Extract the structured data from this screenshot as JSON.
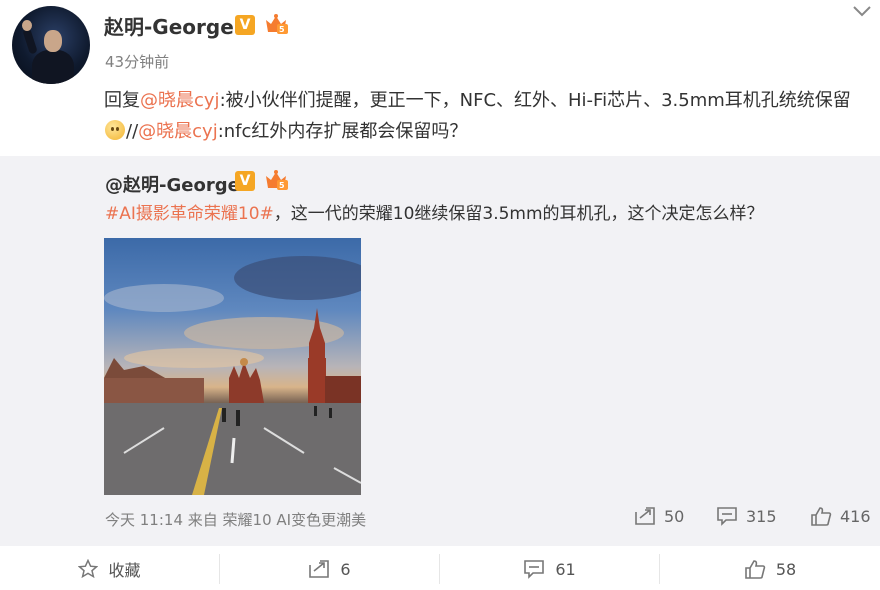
{
  "header": {
    "user_name": "赵明-George",
    "verified_badge": "V",
    "post_time": "43分钟前"
  },
  "post": {
    "prefix": "回复",
    "mention1": "@晓晨cyj",
    "text1": ":被小伙伴们提醒，更正一下，NFC、红外、Hi-Fi芯片、3.5mm耳机孔统统保留",
    "emoji": "smile-emoji",
    "slashes": "//",
    "mention2": "@晓晨cyj",
    "text2": ":nfc红外内存扩展都会保留吗？"
  },
  "retweet": {
    "user_name": "@赵明-George",
    "verified_badge": "V",
    "hashtag": "#AI摄影革命荣耀10#",
    "text": "，这一代的荣耀10继续保留3.5mm的耳机孔，这个决定怎么样？",
    "source": "今天 11:14 来自 荣耀10 AI变色更潮美",
    "stats": {
      "forward": "50",
      "comment": "315",
      "like": "416"
    }
  },
  "footer": {
    "favorite_label": "收藏",
    "forward_count": "6",
    "comment_count": "61",
    "like_count": "58"
  },
  "colors": {
    "link": "#eb7350",
    "badge": "#f5a623",
    "retweet_bg": "#f2f2f5"
  }
}
